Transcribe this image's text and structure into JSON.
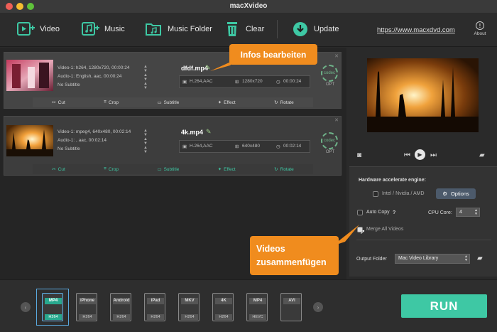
{
  "window": {
    "title": "macXvideo"
  },
  "toolbar": {
    "video": "Video",
    "music": "Music",
    "music_folder": "Music Folder",
    "clear": "Clear",
    "update": "Update",
    "website": "https://www.macxdvd.com",
    "about": "About"
  },
  "items": [
    {
      "video_info": "Video-1: h264, 1280x720, 00:00:24",
      "audio_info": "Audio-1: English, aac, 00:00:24",
      "subtitle": "No Subtitle",
      "filename": "dfdf.mp4",
      "codec": "H.264,AAC",
      "resolution": "1280x720",
      "duration": "00:00:24",
      "codec_badge": "codec",
      "opt": "OPT",
      "actions": [
        "Cut",
        "Crop",
        "Subtitle",
        "Effect",
        "Rotate"
      ]
    },
    {
      "video_info": "Video-1: mpeg4, 640x480, 00:02:14",
      "audio_info": "Audio-1: , aac, 00:02:14",
      "subtitle": "No Subtitle",
      "filename": "4k.mp4",
      "codec": "H.264,AAC",
      "resolution": "640x480",
      "duration": "00:02:14",
      "codec_badge": "codec",
      "opt": "OPT",
      "actions": [
        "Cut",
        "Crop",
        "Subtitle",
        "Effect",
        "Rotate"
      ]
    }
  ],
  "settings": {
    "hw_label": "Hardware accelerate engine:",
    "hw_option": "Intel / Nvidia / AMD",
    "options_button": "Options",
    "auto_copy": "Auto Copy",
    "auto_copy_help": "?",
    "cpu_core_label": "CPU Core:",
    "cpu_core_value": "4",
    "merge_label": "Merge All Videos",
    "output_folder_label": "Output Folder",
    "output_folder_value": "Mac Video Library"
  },
  "presets": [
    {
      "top": "MP4",
      "bottom": "H264",
      "active": true
    },
    {
      "top": "iPhone",
      "bottom": "H264"
    },
    {
      "top": "Android",
      "bottom": "H264"
    },
    {
      "top": "iPad",
      "bottom": "H264"
    },
    {
      "top": "MKV",
      "bottom": "H264"
    },
    {
      "top": "4K",
      "bottom": "H264"
    },
    {
      "top": "MP4",
      "bottom": "HEVC"
    },
    {
      "top": "AVI",
      "bottom": ""
    }
  ],
  "run_button": "RUN",
  "callouts": {
    "edit_info": "Infos bearbeiten",
    "merge_line1": "Videos",
    "merge_line2": "zusammenfügen"
  },
  "colors": {
    "accent": "#3ec8a4",
    "callout": "#f08c1e",
    "selection": "#5aa9de"
  }
}
